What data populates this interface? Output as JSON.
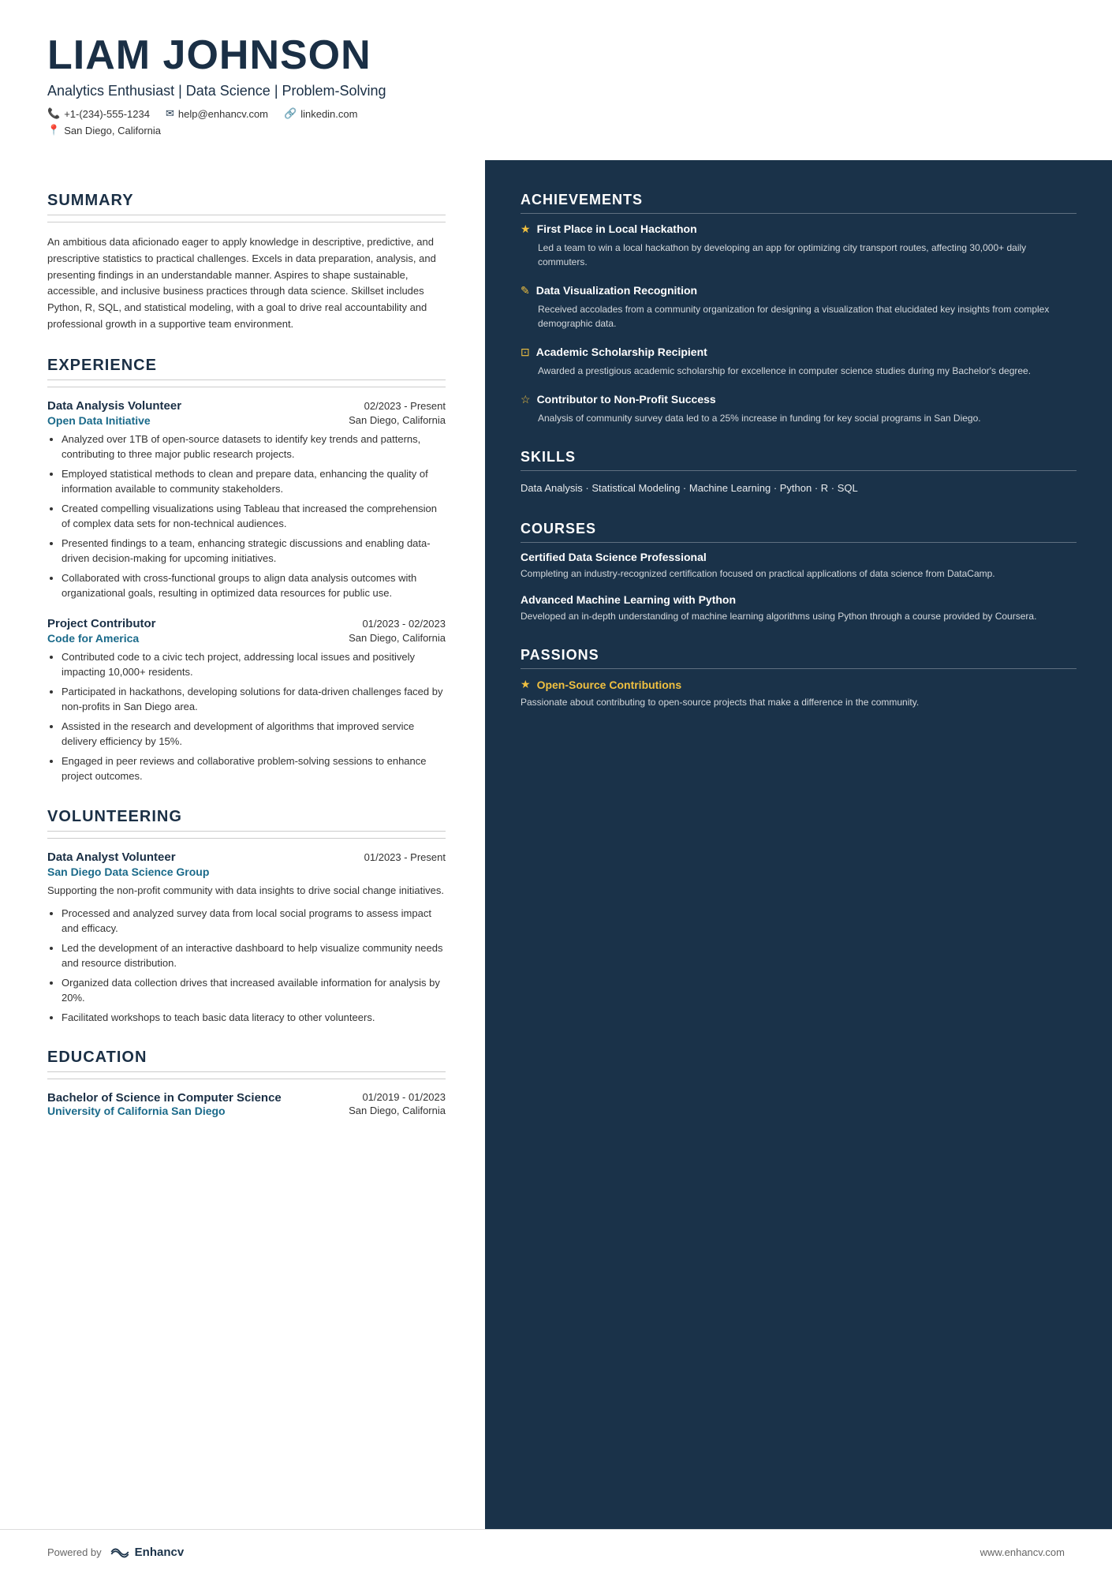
{
  "header": {
    "name": "LIAM JOHNSON",
    "tagline": "Analytics Enthusiast | Data Science | Problem-Solving",
    "phone": "+1-(234)-555-1234",
    "email": "help@enhancv.com",
    "linkedin": "linkedin.com",
    "location": "San Diego, California"
  },
  "summary": {
    "title": "SUMMARY",
    "text": "An ambitious data aficionado eager to apply knowledge in descriptive, predictive, and prescriptive statistics to practical challenges. Excels in data preparation, analysis, and presenting findings in an understandable manner. Aspires to shape sustainable, accessible, and inclusive business practices through data science. Skillset includes Python, R, SQL, and statistical modeling, with a goal to drive real accountability and professional growth in a supportive team environment."
  },
  "experience": {
    "title": "EXPERIENCE",
    "entries": [
      {
        "title": "Data Analysis Volunteer",
        "date": "02/2023 - Present",
        "org": "Open Data Initiative",
        "location": "San Diego, California",
        "bullets": [
          "Analyzed over 1TB of open-source datasets to identify key trends and patterns, contributing to three major public research projects.",
          "Employed statistical methods to clean and prepare data, enhancing the quality of information available to community stakeholders.",
          "Created compelling visualizations using Tableau that increased the comprehension of complex data sets for non-technical audiences.",
          "Presented findings to a team, enhancing strategic discussions and enabling data-driven decision-making for upcoming initiatives.",
          "Collaborated with cross-functional groups to align data analysis outcomes with organizational goals, resulting in optimized data resources for public use."
        ]
      },
      {
        "title": "Project Contributor",
        "date": "01/2023 - 02/2023",
        "org": "Code for America",
        "location": "San Diego, California",
        "bullets": [
          "Contributed code to a civic tech project, addressing local issues and positively impacting 10,000+ residents.",
          "Participated in hackathons, developing solutions for data-driven challenges faced by non-profits in San Diego area.",
          "Assisted in the research and development of algorithms that improved service delivery efficiency by 15%.",
          "Engaged in peer reviews and collaborative problem-solving sessions to enhance project outcomes."
        ]
      }
    ]
  },
  "volunteering": {
    "title": "VOLUNTEERING",
    "entries": [
      {
        "title": "Data Analyst Volunteer",
        "date": "01/2023 - Present",
        "org": "San Diego Data Science Group",
        "location": "",
        "intro": "Supporting the non-profit community with data insights to drive social change initiatives.",
        "bullets": [
          "Processed and analyzed survey data from local social programs to assess impact and efficacy.",
          "Led the development of an interactive dashboard to help visualize community needs and resource distribution.",
          "Organized data collection drives that increased available information for analysis by 20%.",
          "Facilitated workshops to teach basic data literacy to other volunteers."
        ]
      }
    ]
  },
  "education": {
    "title": "EDUCATION",
    "entries": [
      {
        "degree": "Bachelor of Science in Computer Science",
        "date": "01/2019 - 01/2023",
        "school": "University of California San Diego",
        "location": "San Diego, California"
      }
    ]
  },
  "achievements": {
    "title": "ACHIEVEMENTS",
    "items": [
      {
        "icon": "★",
        "title": "First Place in Local Hackathon",
        "desc": "Led a team to win a local hackathon by developing an app for optimizing city transport routes, affecting 30,000+ daily commuters."
      },
      {
        "icon": "✎",
        "title": "Data Visualization Recognition",
        "desc": "Received accolades from a community organization for designing a visualization that elucidated key insights from complex demographic data."
      },
      {
        "icon": "⊡",
        "title": "Academic Scholarship Recipient",
        "desc": "Awarded a prestigious academic scholarship for excellence in computer science studies during my Bachelor's degree."
      },
      {
        "icon": "☆",
        "title": "Contributor to Non-Profit Success",
        "desc": "Analysis of community survey data led to a 25% increase in funding for key social programs in San Diego."
      }
    ]
  },
  "skills": {
    "title": "SKILLS",
    "text": "Data Analysis · Statistical Modeling · Machine Learning · Python · R   · SQL"
  },
  "courses": {
    "title": "COURSES",
    "items": [
      {
        "title": "Certified Data Science Professional",
        "desc": "Completing an industry-recognized certification focused on practical applications of data science from DataCamp."
      },
      {
        "title": "Advanced Machine Learning with Python",
        "desc": "Developed an in-depth understanding of machine learning algorithms using Python through a course provided by Coursera."
      }
    ]
  },
  "passions": {
    "title": "PASSIONS",
    "items": [
      {
        "icon": "★",
        "title": "Open-Source Contributions",
        "desc": "Passionate about contributing to open-source projects that make a difference in the community."
      }
    ]
  },
  "footer": {
    "powered_by": "Powered by",
    "brand": "Enhancv",
    "website": "www.enhancv.com"
  }
}
